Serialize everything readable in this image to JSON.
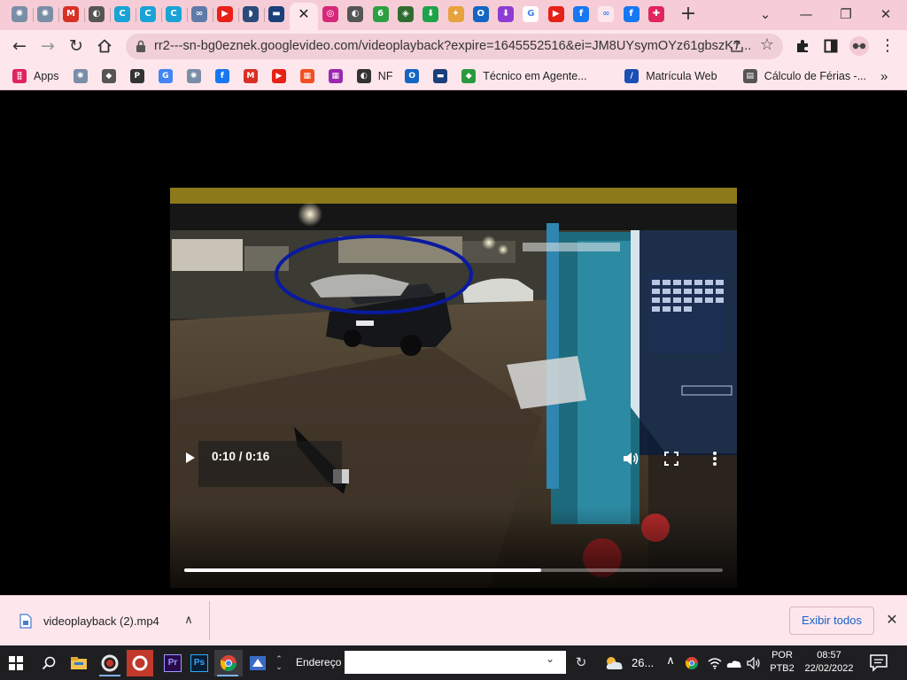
{
  "browser": {
    "tabs": [
      {
        "icon": "seashell-icon",
        "color": "#7a8ea6",
        "glyph": "✺"
      },
      {
        "icon": "seashell-icon",
        "color": "#7a8ea6",
        "glyph": "✺"
      },
      {
        "icon": "gmail-icon",
        "color": "#d93025",
        "glyph": "M"
      },
      {
        "icon": "globe-icon",
        "color": "#555555",
        "glyph": "◐"
      },
      {
        "icon": "canva-icon",
        "color": "#19a3d6",
        "glyph": "C"
      },
      {
        "icon": "canva-icon",
        "color": "#19a3d6",
        "glyph": "C"
      },
      {
        "icon": "canva-icon",
        "color": "#19a3d6",
        "glyph": "C"
      },
      {
        "icon": "link-icon",
        "color": "#5f7aa8",
        "glyph": "∞"
      },
      {
        "icon": "youtube-icon",
        "color": "#e62117",
        "glyph": "▶"
      },
      {
        "icon": "whale-icon",
        "color": "#2b4b7a",
        "glyph": "◗"
      },
      {
        "icon": "bank-logo-icon",
        "color": "#1b3f7a",
        "glyph": "▬"
      }
    ],
    "tabs_after": [
      {
        "icon": "instagram-icon",
        "color": "#d6287b",
        "glyph": "◎"
      },
      {
        "icon": "globe-icon",
        "color": "#555555",
        "glyph": "◐"
      },
      {
        "icon": "green-six-icon",
        "color": "#2ea043",
        "glyph": "6"
      },
      {
        "icon": "shield-badge-icon",
        "color": "#2f6d2f",
        "glyph": "◈"
      },
      {
        "icon": "download-green-icon",
        "color": "#1fa34a",
        "glyph": "⬇"
      },
      {
        "icon": "pinwheel-icon",
        "color": "#e6a23c",
        "glyph": "✦"
      },
      {
        "icon": "outlook-icon",
        "color": "#1466c2",
        "glyph": "O"
      },
      {
        "icon": "download-purple-icon",
        "color": "#8e3bd1",
        "glyph": "⬇"
      },
      {
        "icon": "google-icon",
        "color": "#ffffff",
        "glyph": "G"
      },
      {
        "icon": "youtube-icon",
        "color": "#e62117",
        "glyph": "▶"
      },
      {
        "icon": "facebook-icon",
        "color": "#1877f2",
        "glyph": "f"
      },
      {
        "icon": "meta-icon",
        "color": "#fde7ec",
        "glyph": "∞"
      },
      {
        "icon": "facebook-icon",
        "color": "#1877f2",
        "glyph": "f"
      },
      {
        "icon": "plus-red-icon",
        "color": "#e0245e",
        "glyph": "✚"
      }
    ],
    "active_tab_close": "✕",
    "new_tab": "+",
    "window": {
      "minimize": "—",
      "maximize": "❐",
      "close": "✕",
      "dropdown": "⌄"
    },
    "url": "rr2---sn-bg0eznek.googlevideo.com/videoplayback?expire=1645552516&ei=JM8UYsymOYz61gbszK7..."
  },
  "bookmarks": [
    {
      "icon": "apps-grid-icon",
      "label": "Apps",
      "color": "#e0245e",
      "glyph": "⣿"
    },
    {
      "icon": "seashell-icon",
      "label": "",
      "color": "#7a8ea6",
      "glyph": "✺"
    },
    {
      "icon": "layers-icon",
      "label": "",
      "color": "#555555",
      "glyph": "◆"
    },
    {
      "icon": "p-logo-icon",
      "label": "",
      "color": "#333333",
      "glyph": "P"
    },
    {
      "icon": "google-icon",
      "label": "",
      "color": "#4285f4",
      "glyph": "G"
    },
    {
      "icon": "seashell-icon",
      "label": "",
      "color": "#7a8ea6",
      "glyph": "✺"
    },
    {
      "icon": "facebook-icon",
      "label": "",
      "color": "#1877f2",
      "glyph": "f"
    },
    {
      "icon": "gmail-icon",
      "label": "",
      "color": "#d93025",
      "glyph": "M"
    },
    {
      "icon": "youtube-icon",
      "label": "",
      "color": "#e62117",
      "glyph": "▶"
    },
    {
      "icon": "microsoft-icon",
      "label": "",
      "color": "#f25022",
      "glyph": "▦"
    },
    {
      "icon": "colorful-grid-icon",
      "label": "",
      "color": "#9c27b0",
      "glyph": "▦"
    },
    {
      "icon": "globe-icon",
      "label": "NF",
      "color": "#333333",
      "glyph": "◐"
    },
    {
      "icon": "outlook-icon",
      "label": "",
      "color": "#1466c2",
      "glyph": "O"
    },
    {
      "icon": "bank-logo-icon",
      "label": "",
      "color": "#1b3f7a",
      "glyph": "▬"
    },
    {
      "icon": "brazil-flag-icon",
      "label": "Técnico em Agente...",
      "color": "#2b9a3e",
      "glyph": "◆"
    },
    {
      "icon": "slash-blue-icon",
      "label": "Matrícula Web",
      "color": "#1c4fb3",
      "glyph": "/"
    },
    {
      "icon": "calculator-icon",
      "label": "Cálculo de Férias -...",
      "color": "#555555",
      "glyph": "▤"
    }
  ],
  "bookmarks_overflow": "»",
  "video": {
    "time_display": "0:10 / 0:16",
    "progress_fraction": 0.663
  },
  "download": {
    "filename": "videoplayback (2).mp4",
    "caret": "∧",
    "show_all": "Exibir todos",
    "close": "✕"
  },
  "taskbar": {
    "address_label": "Endereço",
    "address_caret": "⌄",
    "address_refresh": "↻",
    "weather_temp": "26...",
    "tray_chevron": "∧",
    "language": [
      "POR",
      "PTB2"
    ],
    "time": "08:57",
    "date": "22/02/2022"
  },
  "colors": {
    "chrome_tabstrip": "#f6cdd6",
    "chrome_toolbar": "#fde7ec",
    "taskbar": "#1f1f22",
    "link_blue": "#1a5fc8",
    "annotation_circle": "#0a1a9e"
  }
}
